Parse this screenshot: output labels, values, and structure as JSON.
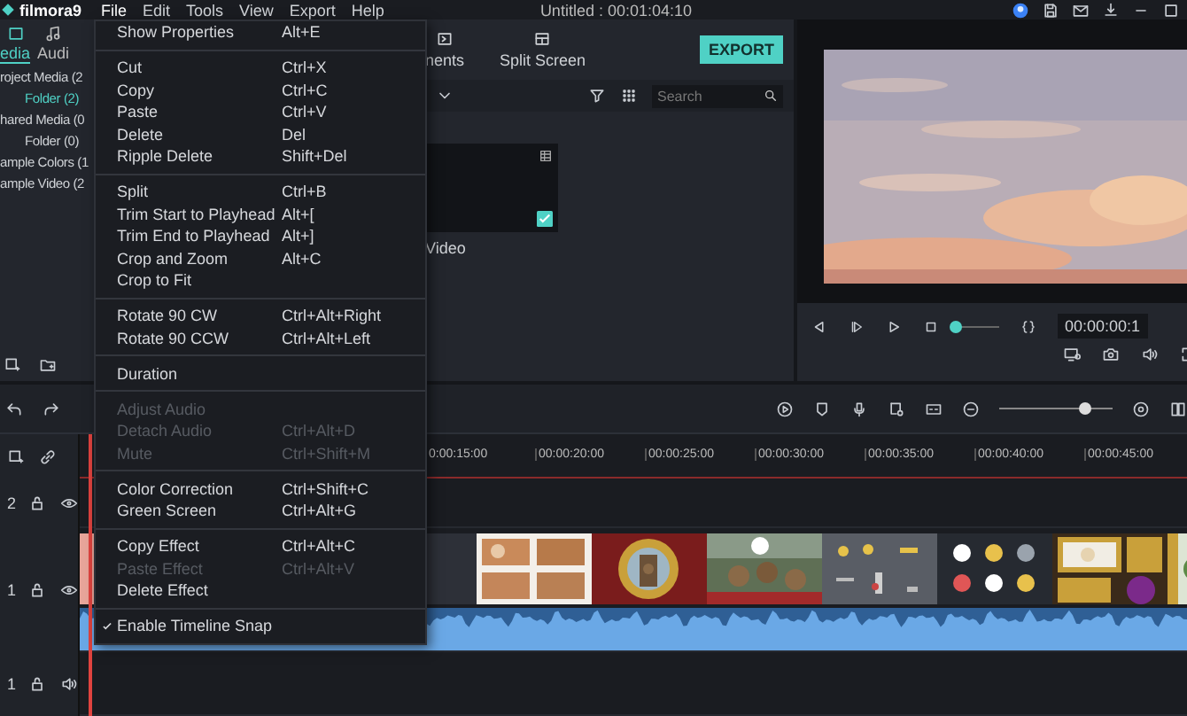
{
  "titlebar": {
    "logo": "filmora9",
    "menus": [
      {
        "label": "File",
        "selected": true
      },
      {
        "label": "Edit",
        "selected": false
      },
      {
        "label": "Tools",
        "selected": false
      },
      {
        "label": "View",
        "selected": false
      },
      {
        "label": "Export",
        "selected": false
      },
      {
        "label": "Help",
        "selected": false
      }
    ],
    "title": "Untitled : 00:01:04:10"
  },
  "library": {
    "tabs": [
      {
        "label": "edia",
        "selected": true
      },
      {
        "label": "Audi",
        "selected": false
      }
    ],
    "folders": [
      {
        "label": "roject Media (2",
        "selected": false,
        "children": [
          {
            "label": "Folder (2)",
            "selected": true
          }
        ]
      },
      {
        "label": "hared Media (0",
        "selected": false,
        "children": [
          {
            "label": "Folder (0)",
            "selected": false
          }
        ]
      },
      {
        "label": "ample Colors (1",
        "selected": false
      },
      {
        "label": "ample Video (2",
        "selected": false
      }
    ]
  },
  "toolbar": {
    "tabs": [
      {
        "label": "nents"
      },
      {
        "label": "Split Screen"
      }
    ],
    "export": "EXPORT",
    "search": {
      "placeholder": "Search"
    }
  },
  "media": [
    {
      "label": "Video",
      "checked": true
    }
  ],
  "preview": {
    "kind": "picture",
    "progress": {
      "level": 0.05
    },
    "timecode": "00:00:00:1"
  },
  "timeline": {
    "zoom": {
      "level": 0.75
    },
    "ruler": [
      "0:00:15:00",
      "00:00:20:00",
      "00:00:25:00",
      "00:00:30:00",
      "00:00:35:00",
      "00:00:40:00",
      "00:00:45:00"
    ],
    "tracks": [
      {
        "number": "2",
        "kind": "video"
      },
      {
        "number": "1",
        "kind": "video"
      },
      {
        "number": "1",
        "kind": "audio"
      }
    ]
  },
  "context_menu": [
    {
      "kind": "item",
      "label": "Show Properties",
      "shortcut": "Alt+E",
      "disabled": false,
      "checked": false
    },
    {
      "kind": "separator"
    },
    {
      "kind": "item",
      "label": "Cut",
      "shortcut": "Ctrl+X",
      "disabled": false,
      "checked": false
    },
    {
      "kind": "item",
      "label": "Copy",
      "shortcut": "Ctrl+C",
      "disabled": false,
      "checked": false
    },
    {
      "kind": "item",
      "label": "Paste",
      "shortcut": "Ctrl+V",
      "disabled": false,
      "checked": false
    },
    {
      "kind": "item",
      "label": "Delete",
      "shortcut": "Del",
      "disabled": false,
      "checked": false
    },
    {
      "kind": "item",
      "label": "Ripple Delete",
      "shortcut": "Shift+Del",
      "disabled": false,
      "checked": false
    },
    {
      "kind": "separator"
    },
    {
      "kind": "item",
      "label": "Split",
      "shortcut": "Ctrl+B",
      "disabled": false,
      "checked": false
    },
    {
      "kind": "item",
      "label": "Trim Start to Playhead",
      "shortcut": "Alt+[",
      "disabled": false,
      "checked": false
    },
    {
      "kind": "item",
      "label": "Trim End to Playhead",
      "shortcut": "Alt+]",
      "disabled": false,
      "checked": false
    },
    {
      "kind": "item",
      "label": "Crop and Zoom",
      "shortcut": "Alt+C",
      "disabled": false,
      "checked": false
    },
    {
      "kind": "item",
      "label": "Crop to Fit",
      "disabled": false,
      "checked": false
    },
    {
      "kind": "separator"
    },
    {
      "kind": "item",
      "label": "Rotate 90 CW",
      "shortcut": "Ctrl+Alt+Right",
      "disabled": false,
      "checked": false
    },
    {
      "kind": "item",
      "label": "Rotate 90 CCW",
      "shortcut": "Ctrl+Alt+Left",
      "disabled": false,
      "checked": false
    },
    {
      "kind": "separator"
    },
    {
      "kind": "item",
      "label": "Duration",
      "disabled": false,
      "checked": false
    },
    {
      "kind": "separator"
    },
    {
      "kind": "item",
      "label": "Adjust Audio",
      "disabled": true,
      "checked": false
    },
    {
      "kind": "item",
      "label": "Detach Audio",
      "shortcut": "Ctrl+Alt+D",
      "disabled": true,
      "checked": false
    },
    {
      "kind": "item",
      "label": "Mute",
      "shortcut": "Ctrl+Shift+M",
      "disabled": true,
      "checked": false
    },
    {
      "kind": "separator"
    },
    {
      "kind": "item",
      "label": "Color Correction",
      "shortcut": "Ctrl+Shift+C",
      "disabled": false,
      "checked": false
    },
    {
      "kind": "item",
      "label": "Green Screen",
      "shortcut": "Ctrl+Alt+G",
      "disabled": false,
      "checked": false
    },
    {
      "kind": "separator"
    },
    {
      "kind": "item",
      "label": "Copy Effect",
      "shortcut": "Ctrl+Alt+C",
      "disabled": false,
      "checked": false
    },
    {
      "kind": "item",
      "label": "Paste Effect",
      "shortcut": "Ctrl+Alt+V",
      "disabled": true,
      "checked": false
    },
    {
      "kind": "item",
      "label": "Delete Effect",
      "disabled": false,
      "checked": false
    },
    {
      "kind": "separator"
    },
    {
      "kind": "item",
      "label": "Enable Timeline Snap",
      "disabled": false,
      "checked": true
    }
  ]
}
